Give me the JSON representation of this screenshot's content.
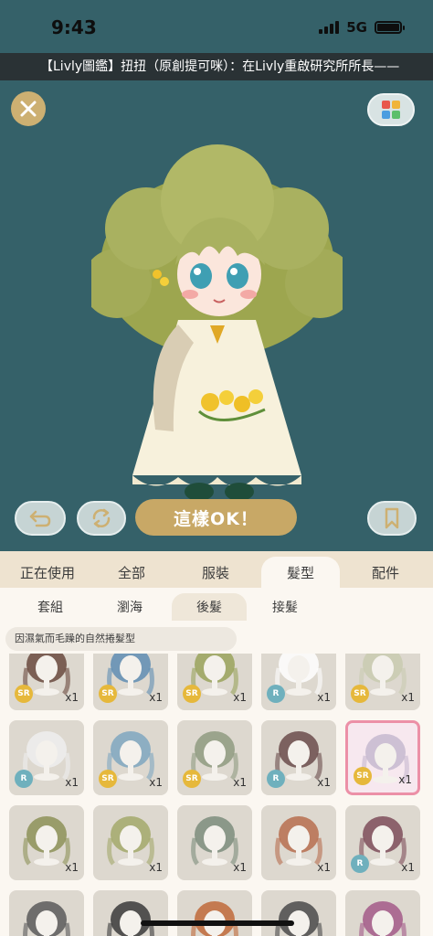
{
  "status_bar": {
    "time": "9:43",
    "network": "5G",
    "signal_icon": "signal-bars-icon",
    "battery_icon": "battery-icon"
  },
  "ticker": {
    "text": "【Livly圖鑑】扭扭（原創提可咪）：在Livly重啟研究所所長——"
  },
  "stage": {
    "background": "#356169",
    "close_icon": "close-icon",
    "palette_icon": "color-palette-icon",
    "undo_icon": "undo-icon",
    "rotate_icon": "rotate-icon",
    "confirm_label": "這樣OK！",
    "bookmark_icon": "bookmark-icon"
  },
  "category_tabs": [
    {
      "label": "正在使用",
      "active": false
    },
    {
      "label": "全部",
      "active": false
    },
    {
      "label": "服裝",
      "active": false
    },
    {
      "label": "髮型",
      "active": true
    },
    {
      "label": "配件",
      "active": false
    }
  ],
  "sub_tabs": [
    {
      "label": "套組",
      "active": false
    },
    {
      "label": "瀏海",
      "active": false
    },
    {
      "label": "後髮",
      "active": true
    },
    {
      "label": "接髮",
      "active": false
    }
  ],
  "description": "因濕氣而毛躁的自然捲髮型",
  "items": [
    {
      "rarity": "SR",
      "qty": "x1",
      "hair": "#6a4a3e"
    },
    {
      "rarity": "SR",
      "qty": "x1",
      "hair": "#5f8db3"
    },
    {
      "rarity": "SR",
      "qty": "x1",
      "hair": "#9aa35c"
    },
    {
      "rarity": "R",
      "qty": "x1",
      "hair": "#ffffff"
    },
    {
      "rarity": "SR",
      "qty": "x1",
      "hair": "#c9cbb0"
    },
    {
      "rarity": "R",
      "qty": "x1",
      "hair": "#efefef"
    },
    {
      "rarity": "SR",
      "qty": "x1",
      "hair": "#7fa7bf"
    },
    {
      "rarity": "SR",
      "qty": "x1",
      "hair": "#8f9b80"
    },
    {
      "rarity": "R",
      "qty": "x1",
      "hair": "#6b4c4b"
    },
    {
      "rarity": "SR",
      "qty": "x1",
      "hair": "#c6b8cf",
      "selected": true
    },
    {
      "rarity": "",
      "qty": "x1",
      "hair": "#8d9258"
    },
    {
      "rarity": "",
      "qty": "x1",
      "hair": "#a3a96b"
    },
    {
      "rarity": "",
      "qty": "x1",
      "hair": "#7d8d7c"
    },
    {
      "rarity": "",
      "qty": "x1",
      "hair": "#b76e4f"
    },
    {
      "rarity": "R",
      "qty": "x1",
      "hair": "#7e4e5a"
    },
    {
      "rarity": "",
      "qty": "",
      "hair": "#5a5a5a"
    },
    {
      "rarity": "",
      "qty": "",
      "hair": "#3a3a3a"
    },
    {
      "rarity": "",
      "qty": "",
      "hair": "#c06a3a"
    },
    {
      "rarity": "",
      "qty": "",
      "hair": "#4a4a4a"
    },
    {
      "rarity": "",
      "qty": "",
      "hair": "#a35a88"
    }
  ]
}
